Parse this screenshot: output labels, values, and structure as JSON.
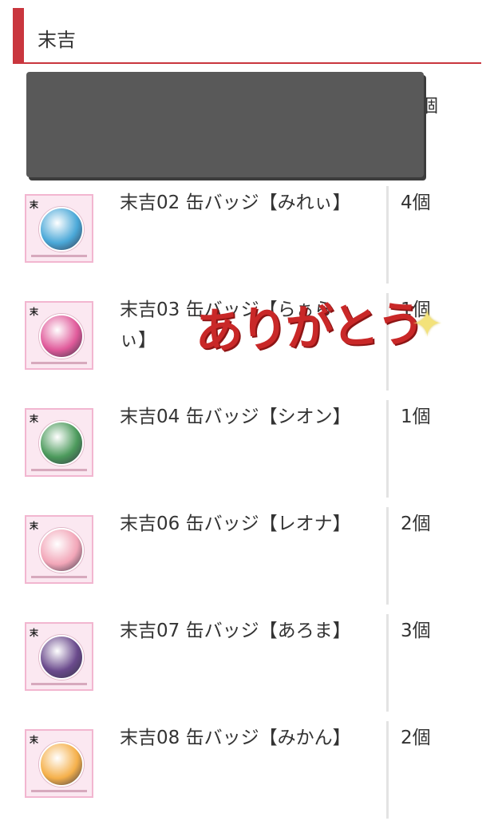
{
  "section": {
    "title": "末吉"
  },
  "hidden_row": {
    "qty_fragment": "個"
  },
  "items": [
    {
      "thumb_brand": "末",
      "name": "末吉02 缶バッジ【みれぃ】",
      "qty": "4個",
      "badge_color": "#4aa8d8"
    },
    {
      "thumb_brand": "末",
      "name": "末吉03 缶バッジ【らぁらぃ】",
      "qty": "1個",
      "badge_color": "#e05a9a"
    },
    {
      "thumb_brand": "末",
      "name": "末吉04 缶バッジ【シオン】",
      "qty": "1個",
      "badge_color": "#4c9a5c"
    },
    {
      "thumb_brand": "末",
      "name": "末吉06 缶バッジ【レオナ】",
      "qty": "2個",
      "badge_color": "#f2a6b8"
    },
    {
      "thumb_brand": "末",
      "name": "末吉07 缶バッジ【あろま】",
      "qty": "3個",
      "badge_color": "#6a4a8c"
    },
    {
      "thumb_brand": "末",
      "name": "末吉08 缶バッジ【みかん】",
      "qty": "2個",
      "badge_color": "#f5b04a"
    }
  ],
  "overlay": {
    "sticker_text": "ありがとう",
    "sparkle": "✦"
  }
}
